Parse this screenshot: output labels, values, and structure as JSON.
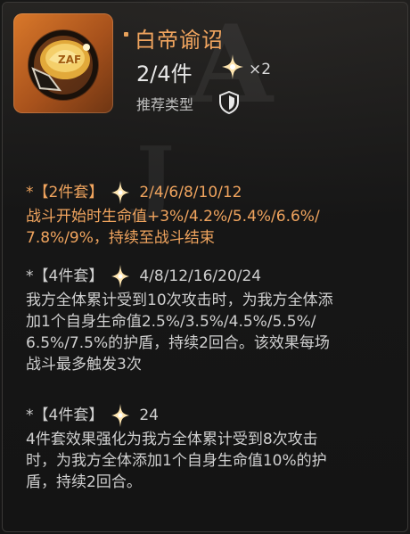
{
  "item": {
    "title": "白帝谕诏",
    "pieces": "2/4件",
    "multiplier": "×2",
    "recommend_label": "推荐类型"
  },
  "sets": [
    {
      "header": "*【2件套】",
      "values": "2/4/6/8/10/12",
      "lines": [
        "战斗开始时生命值+3%/4.2%/5.4%/6.6%/",
        "7.8%/9%，持续至战斗结束"
      ]
    },
    {
      "header": "*【4件套】",
      "values": "4/8/12/16/20/24",
      "lines": [
        "我方全体累计受到10次攻击时，为我方全体添",
        "加1个自身生命值2.5%/3.5%/4.5%/5.5%/",
        "6.5%/7.5%的护盾，持续2回合。该效果每场",
        "战斗最多触发3次"
      ]
    },
    {
      "header": "*【4件套】",
      "values": "24",
      "lines": [
        "4件套效果强化为我方全体累计受到8次攻击",
        "时，为我方全体添加1个自身生命值10%的护",
        "盾，持续2回合。"
      ]
    }
  ],
  "colors": {
    "accent": "#f0a45e",
    "text": "#cfcfcf",
    "background": "#1b1a19"
  },
  "icons": [
    "item-emblem-icon",
    "sparkle-icon",
    "shield-icon"
  ]
}
